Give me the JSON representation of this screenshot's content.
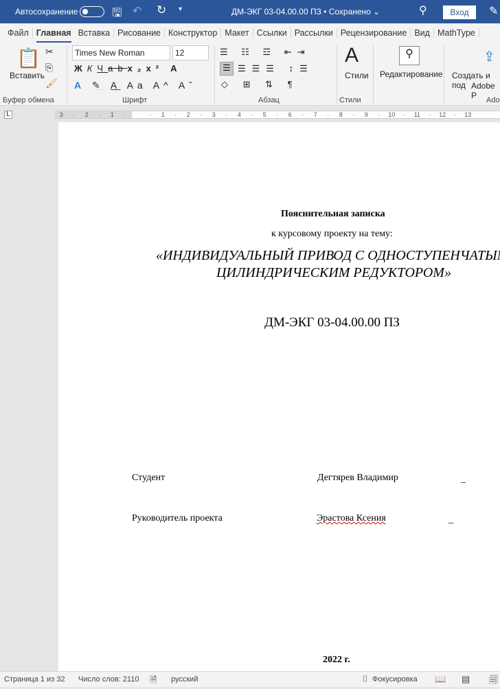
{
  "titlebar": {
    "autosave_label": "Автосохранение",
    "doc_title": "ДМ-ЭКГ 03-04.00.00 ПЗ • Сохранено ⌄",
    "login": "Вход"
  },
  "tabs": [
    "Файл",
    "Главная",
    "Вставка",
    "Рисование",
    "Конструктор",
    "Макет",
    "Ссылки",
    "Рассылки",
    "Рецензирование",
    "Вид",
    "MathType"
  ],
  "ribbon": {
    "paste": "Вставить",
    "font_name": "Times New Roman",
    "font_size": "12",
    "styles": "Стили",
    "editing": "Редактирование",
    "adobe": "Создать и под",
    "adobe2": "Adobe P",
    "groups": {
      "clipboard": "Буфер обмена",
      "font": "Шрифт",
      "paragraph": "Абзац",
      "styles": "Стили",
      "adobe": "Ado"
    }
  },
  "ruler": [
    "3",
    "·",
    "2",
    "·",
    "1",
    "·",
    "",
    "·",
    "1",
    "·",
    "2",
    "·",
    "3",
    "·",
    "4",
    "·",
    "5",
    "·",
    "6",
    "·",
    "7",
    "·",
    "8",
    "·",
    "9",
    "·",
    "10",
    "·",
    "11",
    "·",
    "12",
    "·",
    "13"
  ],
  "document": {
    "heading": "Пояснительная записка",
    "subheading": "к курсовому проекту на тему:",
    "topic1": "«ИНДИВИДУАЛЬНЫЙ ПРИВОД С ОДНОСТУПЕНЧАТЫМ",
    "topic2": "ЦИЛИНДРИЧЕСКИМ РЕДУКТОРОМ»",
    "code": "ДМ-ЭКГ 03-04.00.00 ПЗ",
    "student_label": "Студент",
    "student_name": "Дегтярев Владимир",
    "supervisor_label": "Руководитель проекта",
    "supervisor_name": "Эрастова Ксения",
    "blank": "_",
    "year": "2022 г."
  },
  "status": {
    "page": "Страница 1 из 32",
    "words": "Число слов: 2110",
    "language": "русский",
    "focus": "Фокусировка"
  }
}
